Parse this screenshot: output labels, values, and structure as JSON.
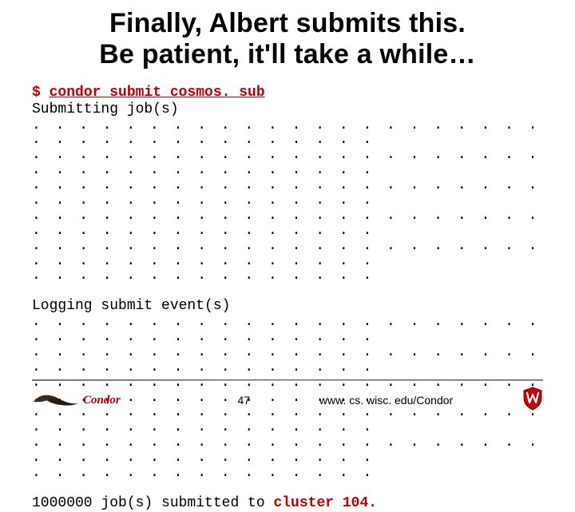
{
  "title_line1": "Finally, Albert submits this.",
  "title_line2": "Be patient, it'll take a while…",
  "terminal": {
    "prompt": "$ ",
    "command": "condor_submit cosmos. sub",
    "submitting": "Submitting job(s)",
    "dots_full": ". . . . . . . . . . . . . . . . . . . . . . . . . . . . . . . . . . . . .",
    "dots_short": ". . . . . . . . . . . . . . .",
    "logging": "Logging submit event(s)",
    "result_prefix": "1000000 job(s) submitted to ",
    "result_cluster": "cluster 104."
  },
  "footer": {
    "page": "47",
    "url": "www. cs. wisc. edu/Condor",
    "logo_text": "Condor"
  }
}
